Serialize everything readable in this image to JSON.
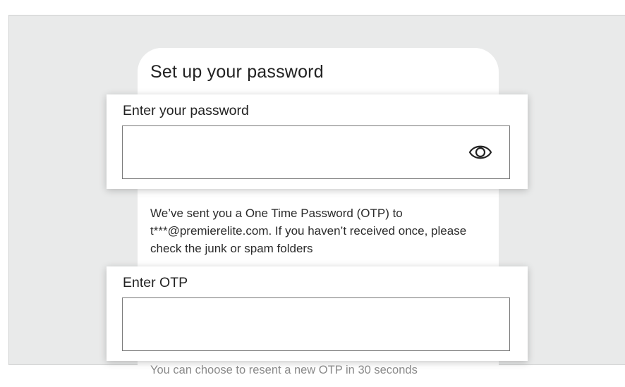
{
  "card": {
    "title": "Set up your password"
  },
  "password": {
    "label": "Enter your password",
    "value": "",
    "toggle_icon": "eye-icon"
  },
  "otp_info": "We’ve sent you a One Time Password (OTP) to t***@premierelite.com. If you haven’t received once, please check the junk or spam folders",
  "otp": {
    "label": "Enter OTP",
    "value": "",
    "helper": "You can choose to resent a new OTP in 30 seconds"
  },
  "colors": {
    "backdrop": "#e9eaea",
    "card": "#ffffff",
    "text": "#222222",
    "muted": "#8a8a8a",
    "input_border": "#7a7a7a"
  }
}
